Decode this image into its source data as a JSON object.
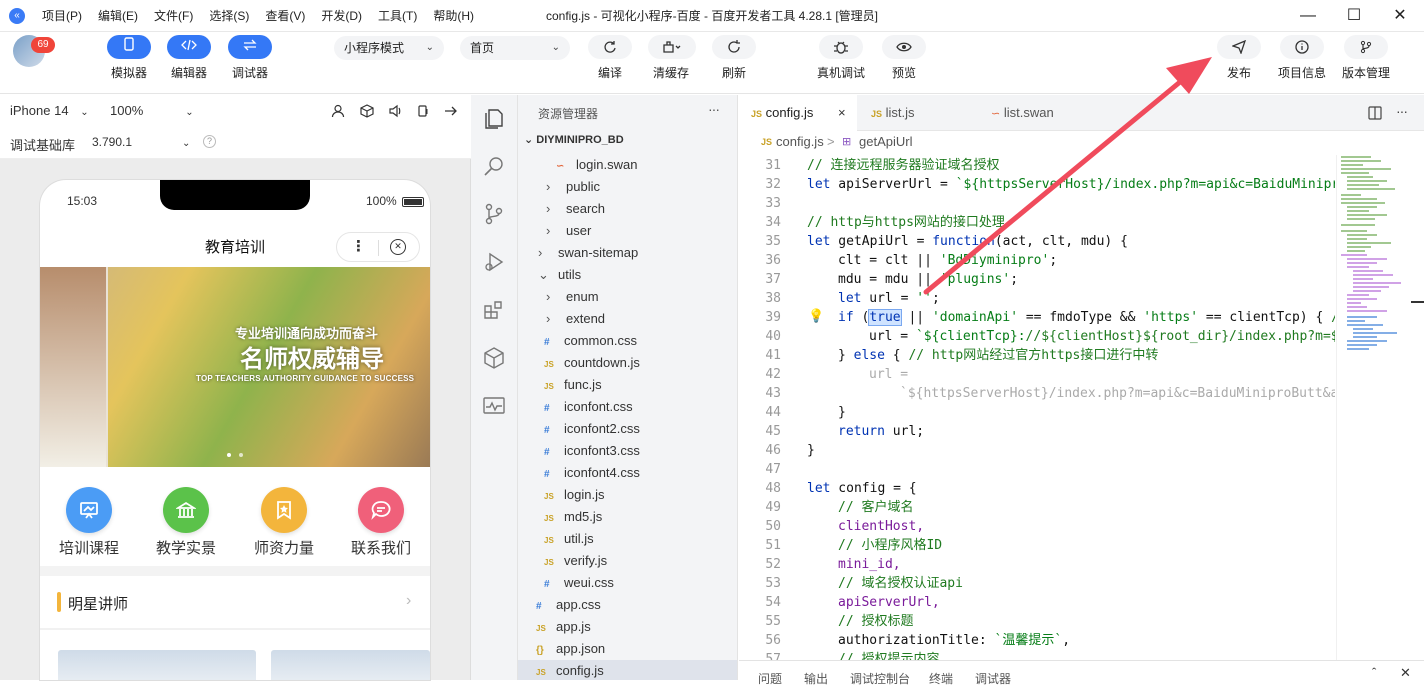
{
  "window": {
    "title": "config.js - 可视化小程序-百度 - 百度开发者工具 4.28.1 [管理员]",
    "menus": [
      "项目(P)",
      "编辑(E)",
      "文件(F)",
      "选择(S)",
      "查看(V)",
      "开发(D)",
      "工具(T)",
      "帮助(H)"
    ],
    "min_icon": "minimize-icon",
    "max_icon": "maximize-icon",
    "close_icon": "close-icon"
  },
  "toolbar": {
    "badge": "69",
    "simulator_label": "模拟器",
    "editor_label": "编辑器",
    "debugger_label": "调试器",
    "mode_select": "小程序模式",
    "page_select": "首页",
    "compile_label": "编译",
    "clear_cache_label": "清缓存",
    "refresh_label": "刷新",
    "device_debug_label": "真机调试",
    "preview_label": "预览",
    "publish_label": "发布",
    "project_info_label": "项目信息",
    "version_label": "版本管理"
  },
  "simulator": {
    "device": "iPhone 14",
    "zoom": "100%",
    "base_lib_label": "调试基础库",
    "base_lib_version": "3.790.1",
    "time": "15:03",
    "battery": "100%",
    "page_title": "教育培训",
    "banner_line1": "专业培训通向成功而奋斗",
    "banner_line2": "名师权威辅导",
    "banner_line3": "TOP TEACHERS AUTHORITY GUIDANCE TO SUCCESS",
    "nav": [
      {
        "label": "培训课程",
        "color": "#4b9cf5"
      },
      {
        "label": "教学实景",
        "color": "#5bc24a"
      },
      {
        "label": "师资力量",
        "color": "#f3b53c"
      },
      {
        "label": "联系我们",
        "color": "#f0607a"
      }
    ],
    "section_title": "明星讲师"
  },
  "explorer": {
    "title": "资源管理器",
    "more": "···",
    "root": "DIYMINIPRO_BD",
    "items": [
      {
        "label": "login.swan",
        "type": "swan",
        "icon": "rss"
      },
      {
        "label": "public",
        "type": "folder",
        "icon": "›"
      },
      {
        "label": "search",
        "type": "folder",
        "icon": "›"
      },
      {
        "label": "user",
        "type": "folder",
        "icon": "›"
      },
      {
        "label": "swan-sitemap",
        "type": "folder",
        "icon": "›"
      },
      {
        "label": "utils",
        "type": "folder-open",
        "icon": "⌄"
      },
      {
        "label": "enum",
        "type": "folder",
        "icon": "›"
      },
      {
        "label": "extend",
        "type": "folder",
        "icon": "›"
      },
      {
        "label": "common.css",
        "type": "css",
        "icon": "#"
      },
      {
        "label": "countdown.js",
        "type": "js",
        "icon": "JS"
      },
      {
        "label": "func.js",
        "type": "js",
        "icon": "JS"
      },
      {
        "label": "iconfont.css",
        "type": "css",
        "icon": "#"
      },
      {
        "label": "iconfont2.css",
        "type": "css",
        "icon": "#"
      },
      {
        "label": "iconfont3.css",
        "type": "css",
        "icon": "#"
      },
      {
        "label": "iconfont4.css",
        "type": "css",
        "icon": "#"
      },
      {
        "label": "login.js",
        "type": "js",
        "icon": "JS"
      },
      {
        "label": "md5.js",
        "type": "js",
        "icon": "JS"
      },
      {
        "label": "util.js",
        "type": "js",
        "icon": "JS"
      },
      {
        "label": "verify.js",
        "type": "js",
        "icon": "JS"
      },
      {
        "label": "weui.css",
        "type": "css",
        "icon": "#"
      },
      {
        "label": "app.css",
        "type": "css",
        "icon": "#"
      },
      {
        "label": "app.js",
        "type": "js",
        "icon": "JS"
      },
      {
        "label": "app.json",
        "type": "json",
        "icon": "{}"
      },
      {
        "label": "config.js",
        "type": "js",
        "icon": "JS"
      }
    ]
  },
  "editor": {
    "tabs": [
      {
        "label": "config.js",
        "icon": "JS",
        "close": "×"
      },
      {
        "label": "list.js",
        "icon": "JS"
      },
      {
        "label": "list.swan",
        "icon": "rss"
      }
    ],
    "breadcrumb_file": "config.js",
    "breadcrumb_sep": ">",
    "breadcrumb_symbol": "getApiUrl",
    "lines": [
      {
        "n": "31",
        "text": "// 连接远程服务器验证域名授权",
        "indent": 0,
        "cls": "cm"
      },
      {
        "n": "32",
        "text": "let apiServerUrl = `${httpsServerHost}/index.php?m=api&c=BaiduMinipro",
        "indent": 0,
        "cls": "mix"
      },
      {
        "n": "33",
        "text": "",
        "indent": 0,
        "cls": ""
      },
      {
        "n": "34",
        "text": "// http与https网站的接口处理",
        "indent": 0,
        "cls": "cm"
      },
      {
        "n": "35",
        "text": "let getApiUrl = function(act, clt, mdu) {",
        "indent": 0,
        "cls": "mix"
      },
      {
        "n": "36",
        "text": "clt = clt || 'BdDiyminipro';",
        "indent": 1,
        "cls": "mix"
      },
      {
        "n": "37",
        "text": "mdu = mdu || 'plugins';",
        "indent": 1,
        "cls": "mix"
      },
      {
        "n": "38",
        "text": "let url = '';",
        "indent": 1,
        "cls": "mix"
      },
      {
        "n": "39",
        "text": "if (true || 'domainApi' == fmdoType && 'https' == clientTcp) { //",
        "indent": 1,
        "cls": "mix"
      },
      {
        "n": "40",
        "text": "url = `${clientTcp}://${clientHost}${root_dir}/index.php?m=$",
        "indent": 2,
        "cls": "mix"
      },
      {
        "n": "41",
        "text": "} else { // http网站经过官方https接口进行中转",
        "indent": 1,
        "cls": "mix"
      },
      {
        "n": "42",
        "text": "url =",
        "indent": 2,
        "cls": "grey"
      },
      {
        "n": "43",
        "text": "`${httpsServerHost}/index.php?m=api&c=BaiduMiniproButt&a=",
        "indent": 3,
        "cls": "grey"
      },
      {
        "n": "44",
        "text": "}",
        "indent": 1,
        "cls": "op"
      },
      {
        "n": "45",
        "text": "return url;",
        "indent": 1,
        "cls": "mix"
      },
      {
        "n": "46",
        "text": "}",
        "indent": 0,
        "cls": "op"
      },
      {
        "n": "47",
        "text": "",
        "indent": 0,
        "cls": ""
      },
      {
        "n": "48",
        "text": "let config = {",
        "indent": 0,
        "cls": "mix"
      },
      {
        "n": "49",
        "text": "// 客户域名",
        "indent": 1,
        "cls": "cm"
      },
      {
        "n": "50",
        "text": "clientHost,",
        "indent": 1,
        "cls": "var"
      },
      {
        "n": "51",
        "text": "// 小程序风格ID",
        "indent": 1,
        "cls": "cm"
      },
      {
        "n": "52",
        "text": "mini_id,",
        "indent": 1,
        "cls": "var"
      },
      {
        "n": "53",
        "text": "// 域名授权认证api",
        "indent": 1,
        "cls": "cm"
      },
      {
        "n": "54",
        "text": "apiServerUrl,",
        "indent": 1,
        "cls": "var"
      },
      {
        "n": "55",
        "text": "// 授权标题",
        "indent": 1,
        "cls": "cm"
      },
      {
        "n": "56",
        "text": "authorizationTitle: `温馨提示`,",
        "indent": 1,
        "cls": "mix"
      },
      {
        "n": "57",
        "text": "// 授权提示内容",
        "indent": 1,
        "cls": "cm"
      }
    ],
    "bottom_tabs": [
      "问题",
      "输出",
      "调试控制台",
      "终端",
      "调试器"
    ]
  },
  "colors": {
    "accent": "#3478f6",
    "arrow": "#f04b5c",
    "badge": "#f0453a"
  }
}
